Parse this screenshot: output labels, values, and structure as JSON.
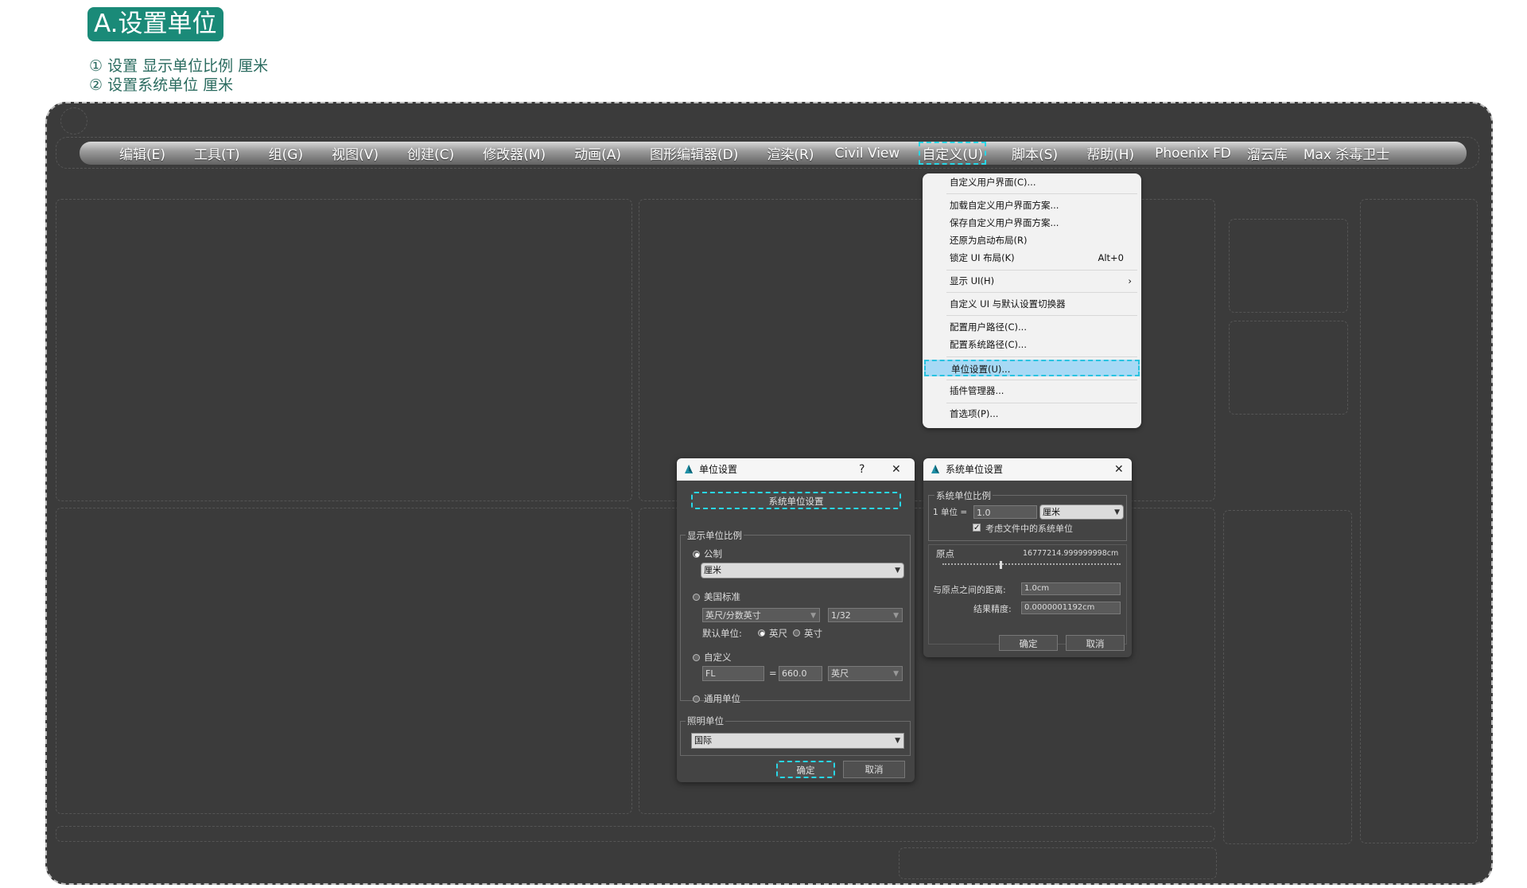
{
  "header": {
    "title": "A.设置单位",
    "steps": [
      "① 设置 显示单位比例 厘米",
      "② 设置系统单位 厘米"
    ]
  },
  "menubar": {
    "items": [
      "编辑(E)",
      "工具(T)",
      "组(G)",
      "视图(V)",
      "创建(C)",
      "修改器(M)",
      "动画(A)",
      "图形编辑器(D)",
      "渲染(R)",
      "Civil View",
      "自定义(U)",
      "脚本(S)",
      "帮助(H)",
      "Phoenix FD",
      "溜云库",
      "Max 杀毒卫士"
    ],
    "active": "自定义(U)"
  },
  "customize_menu": {
    "items": [
      {
        "label": "自定义用户界面(C)..."
      },
      {
        "label": "加载自定义用户界面方案..."
      },
      {
        "label": "保存自定义用户界面方案..."
      },
      {
        "label": "还原为启动布局(R)"
      },
      {
        "label": "锁定 UI 布局(K)",
        "shortcut": "Alt+0"
      },
      {
        "label": "显示 UI(H)",
        "submenu": "›"
      },
      {
        "label": "自定义 UI 与默认设置切换器"
      },
      {
        "label": "配置用户路径(C)..."
      },
      {
        "label": "配置系统路径(C)..."
      },
      {
        "label": "单位设置(U)...",
        "highlighted": true
      },
      {
        "label": "插件管理器..."
      },
      {
        "label": "首选项(P)..."
      }
    ]
  },
  "units_dialog": {
    "title": "单位设置",
    "help": "?",
    "close": "✕",
    "system_units_button": "系统单位设置",
    "display_group_label": "显示单位比例",
    "metric_label": "公制",
    "metric_value": "厘米",
    "us_label": "美国标准",
    "us_value": "英尺/分数英寸",
    "us_fraction": "1/32",
    "default_unit_label": "默认单位:",
    "feet_label": "英尺",
    "inches_label": "英寸",
    "custom_label": "自定义",
    "custom_name": "FL",
    "equals": "=",
    "custom_value": "660.0",
    "custom_unit": "英尺",
    "generic_label": "通用单位",
    "lighting_group_label": "照明单位",
    "lighting_value": "国际",
    "ok": "确定",
    "cancel": "取消"
  },
  "system_dialog": {
    "title": "系统单位设置",
    "close": "✕",
    "scale_group_label": "系统单位比例",
    "one_unit_label": "1 单位 =",
    "scale_value": "1.0",
    "unit_value": "厘米",
    "consider_label": "考虑文件中的系统单位",
    "origin_label": "原点",
    "origin_value": "16777214.999999998cm",
    "distance_label": "与原点之间的距离:",
    "distance_value": "1.0cm",
    "precision_label": "结果精度:",
    "precision_value": "0.0000001192cm",
    "ok": "确定",
    "cancel": "取消"
  }
}
